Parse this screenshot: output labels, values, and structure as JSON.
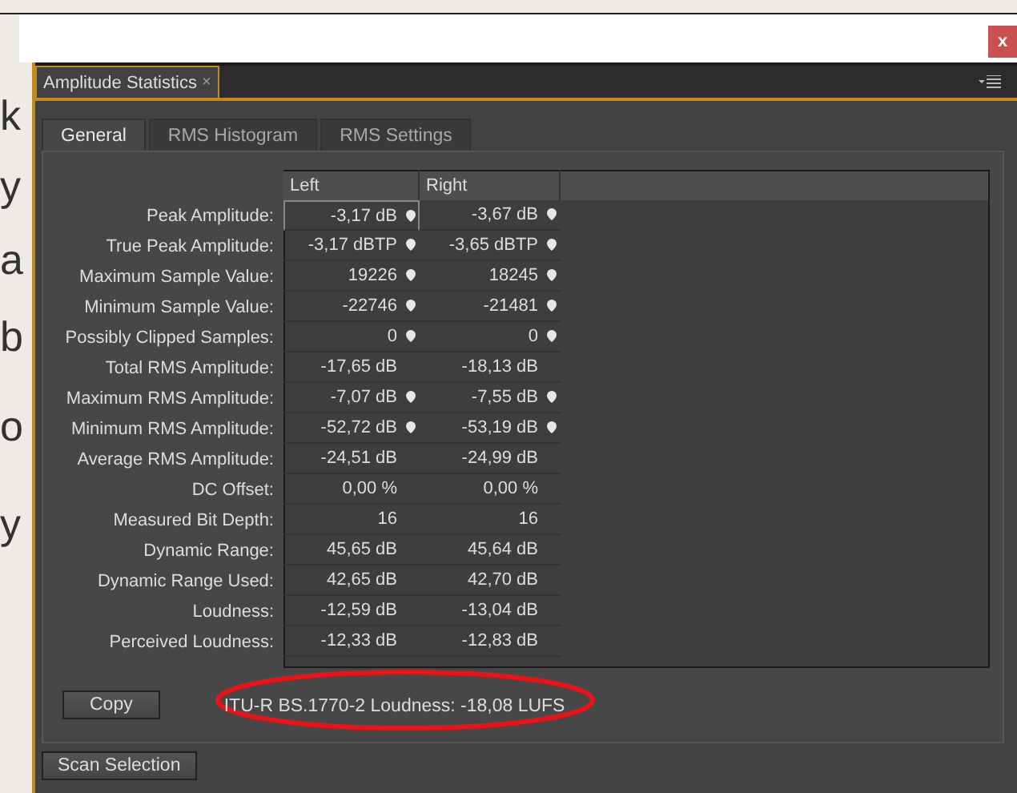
{
  "background_text": [
    "k",
    "y",
    "a",
    "b",
    "o",
    "y"
  ],
  "panel": {
    "title": "Amplitude Statistics",
    "close": "×"
  },
  "tabs": [
    {
      "label": "General",
      "selected": true
    },
    {
      "label": "RMS Histogram",
      "selected": false
    },
    {
      "label": "RMS Settings",
      "selected": false
    }
  ],
  "table": {
    "columns": [
      "Left",
      "Right"
    ],
    "rows": [
      {
        "label": "Peak Amplitude:",
        "cells": [
          {
            "value": "-3,17 dB",
            "marker": true,
            "selected": true
          },
          {
            "value": "-3,67 dB",
            "marker": true,
            "selected": false
          }
        ]
      },
      {
        "label": "True Peak Amplitude:",
        "cells": [
          {
            "value": "-3,17 dBTP",
            "marker": true,
            "selected": false
          },
          {
            "value": "-3,65 dBTP",
            "marker": true,
            "selected": false
          }
        ]
      },
      {
        "label": "Maximum Sample Value:",
        "cells": [
          {
            "value": "19226",
            "marker": true,
            "selected": false
          },
          {
            "value": "18245",
            "marker": true,
            "selected": false
          }
        ]
      },
      {
        "label": "Minimum Sample Value:",
        "cells": [
          {
            "value": "-22746",
            "marker": true,
            "selected": false
          },
          {
            "value": "-21481",
            "marker": true,
            "selected": false
          }
        ]
      },
      {
        "label": "Possibly Clipped Samples:",
        "cells": [
          {
            "value": "0",
            "marker": true,
            "selected": false
          },
          {
            "value": "0",
            "marker": true,
            "selected": false
          }
        ]
      },
      {
        "label": "Total RMS Amplitude:",
        "cells": [
          {
            "value": "-17,65 dB",
            "marker": false,
            "selected": false
          },
          {
            "value": "-18,13 dB",
            "marker": false,
            "selected": false
          }
        ]
      },
      {
        "label": "Maximum RMS Amplitude:",
        "cells": [
          {
            "value": "-7,07 dB",
            "marker": true,
            "selected": false
          },
          {
            "value": "-7,55 dB",
            "marker": true,
            "selected": false
          }
        ]
      },
      {
        "label": "Minimum RMS Amplitude:",
        "cells": [
          {
            "value": "-52,72 dB",
            "marker": true,
            "selected": false
          },
          {
            "value": "-53,19 dB",
            "marker": true,
            "selected": false
          }
        ]
      },
      {
        "label": "Average RMS Amplitude:",
        "cells": [
          {
            "value": "-24,51 dB",
            "marker": false,
            "selected": false
          },
          {
            "value": "-24,99 dB",
            "marker": false,
            "selected": false
          }
        ]
      },
      {
        "label": "DC Offset:",
        "cells": [
          {
            "value": "0,00 %",
            "marker": false,
            "selected": false
          },
          {
            "value": "0,00 %",
            "marker": false,
            "selected": false
          }
        ]
      },
      {
        "label": "Measured Bit Depth:",
        "cells": [
          {
            "value": "16",
            "marker": false,
            "selected": false
          },
          {
            "value": "16",
            "marker": false,
            "selected": false
          }
        ]
      },
      {
        "label": "Dynamic Range:",
        "cells": [
          {
            "value": "45,65 dB",
            "marker": false,
            "selected": false
          },
          {
            "value": "45,64 dB",
            "marker": false,
            "selected": false
          }
        ]
      },
      {
        "label": "Dynamic Range Used:",
        "cells": [
          {
            "value": "42,65 dB",
            "marker": false,
            "selected": false
          },
          {
            "value": "42,70 dB",
            "marker": false,
            "selected": false
          }
        ]
      },
      {
        "label": "Loudness:",
        "cells": [
          {
            "value": "-12,59 dB",
            "marker": false,
            "selected": false
          },
          {
            "value": "-13,04 dB",
            "marker": false,
            "selected": false
          }
        ]
      },
      {
        "label": "Perceived Loudness:",
        "cells": [
          {
            "value": "-12,33 dB",
            "marker": false,
            "selected": false
          },
          {
            "value": "-12,83 dB",
            "marker": false,
            "selected": false
          }
        ]
      }
    ]
  },
  "copy_button": "Copy",
  "loudness": "ITU-R BS.1770-2 Loudness: -18,08 LUFS",
  "scan_button": "Scan Selection",
  "close_button": "x"
}
